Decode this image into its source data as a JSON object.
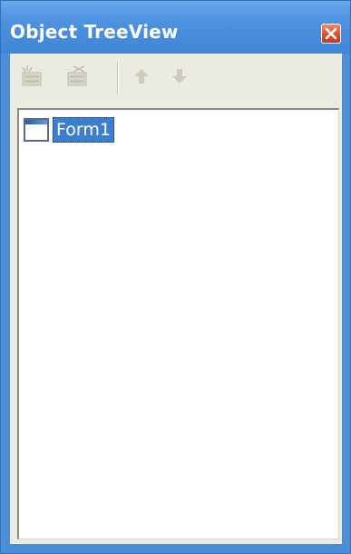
{
  "window": {
    "title": "Object TreeView",
    "accent": "#4a8fd8",
    "close_color": "#e0502d"
  },
  "toolbar": {
    "items": [
      {
        "name": "add-object-icon",
        "enabled": false
      },
      {
        "name": "remove-object-icon",
        "enabled": false
      },
      {
        "name": "move-up-arrow-icon",
        "enabled": false
      },
      {
        "name": "move-down-arrow-icon",
        "enabled": false
      }
    ]
  },
  "tree": {
    "nodes": [
      {
        "label": "Form1",
        "icon": "form-window-icon",
        "selected": true
      }
    ]
  }
}
